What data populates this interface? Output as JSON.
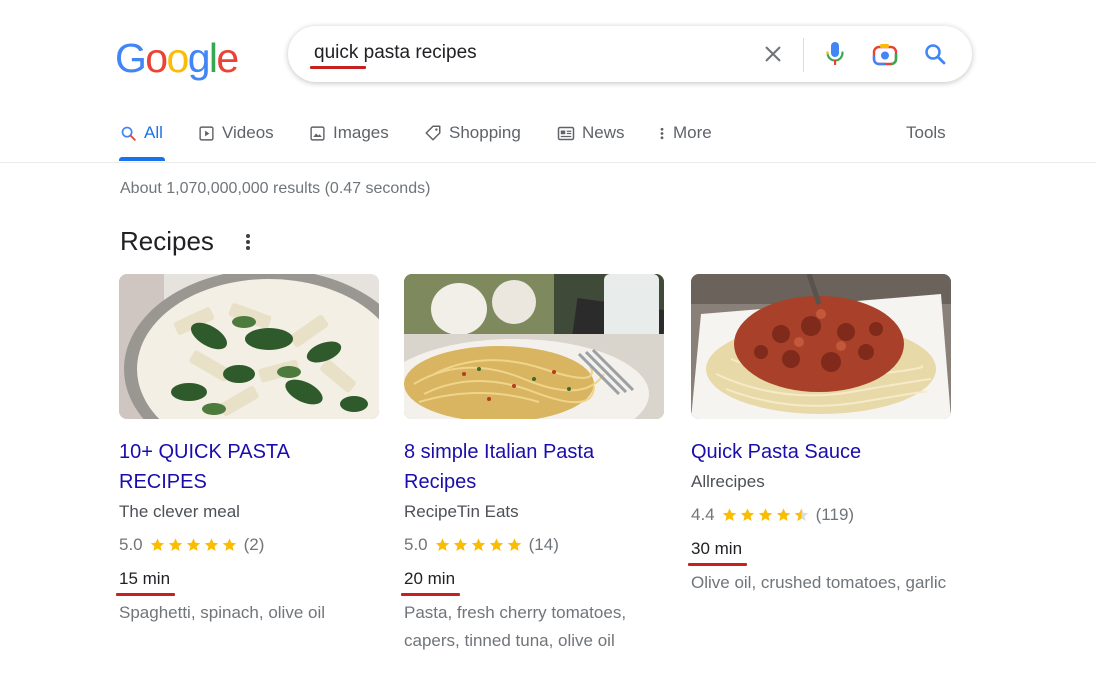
{
  "logo": {
    "letters": [
      "G",
      "o",
      "o",
      "g",
      "l",
      "e"
    ],
    "colors": [
      "#4285F4",
      "#EA4335",
      "#FBBC05",
      "#4285F4",
      "#34A853",
      "#EA4335"
    ]
  },
  "search": {
    "query": "quick pasta recipes"
  },
  "tabs": [
    {
      "label": "All",
      "icon": "search-icon",
      "active": true
    },
    {
      "label": "Videos",
      "icon": "video-icon"
    },
    {
      "label": "Images",
      "icon": "image-icon"
    },
    {
      "label": "Shopping",
      "icon": "tag-icon"
    },
    {
      "label": "News",
      "icon": "newspaper-icon"
    },
    {
      "label": "More",
      "icon": "more-vert-icon"
    }
  ],
  "tools_label": "Tools",
  "result_stats": "About 1,070,000,000 results (0.47 seconds)",
  "section_title": "Recipes",
  "recipes": [
    {
      "title": "10+ QUICK PASTA RECIPES",
      "source": "The clever meal",
      "rating": "5.0",
      "stars": 5,
      "reviews": "(2)",
      "time": "15 min",
      "ingredients": "Spaghetti, spinach, olive oil",
      "image": "penne-spinach-photo"
    },
    {
      "title": "8 simple Italian Pasta Recipes",
      "source": "RecipeTin Eats",
      "rating": "5.0",
      "stars": 5,
      "reviews": "(14)",
      "time": "20 min",
      "ingredients": "Pasta, fresh cherry tomatoes, capers, tinned tuna, olive oil",
      "image": "spaghetti-garlic-photo"
    },
    {
      "title": "Quick Pasta Sauce",
      "source": "Allrecipes",
      "rating": "4.4",
      "stars": 4.5,
      "reviews": "(119)",
      "time": "30 min",
      "ingredients": "Olive oil, crushed tomatoes, garlic",
      "image": "spaghetti-meat-sauce-photo"
    }
  ],
  "colors": {
    "link": "#1a0dab",
    "accent": "#1a73e8",
    "star": "#fbbc04",
    "underline": "#c5221f"
  }
}
